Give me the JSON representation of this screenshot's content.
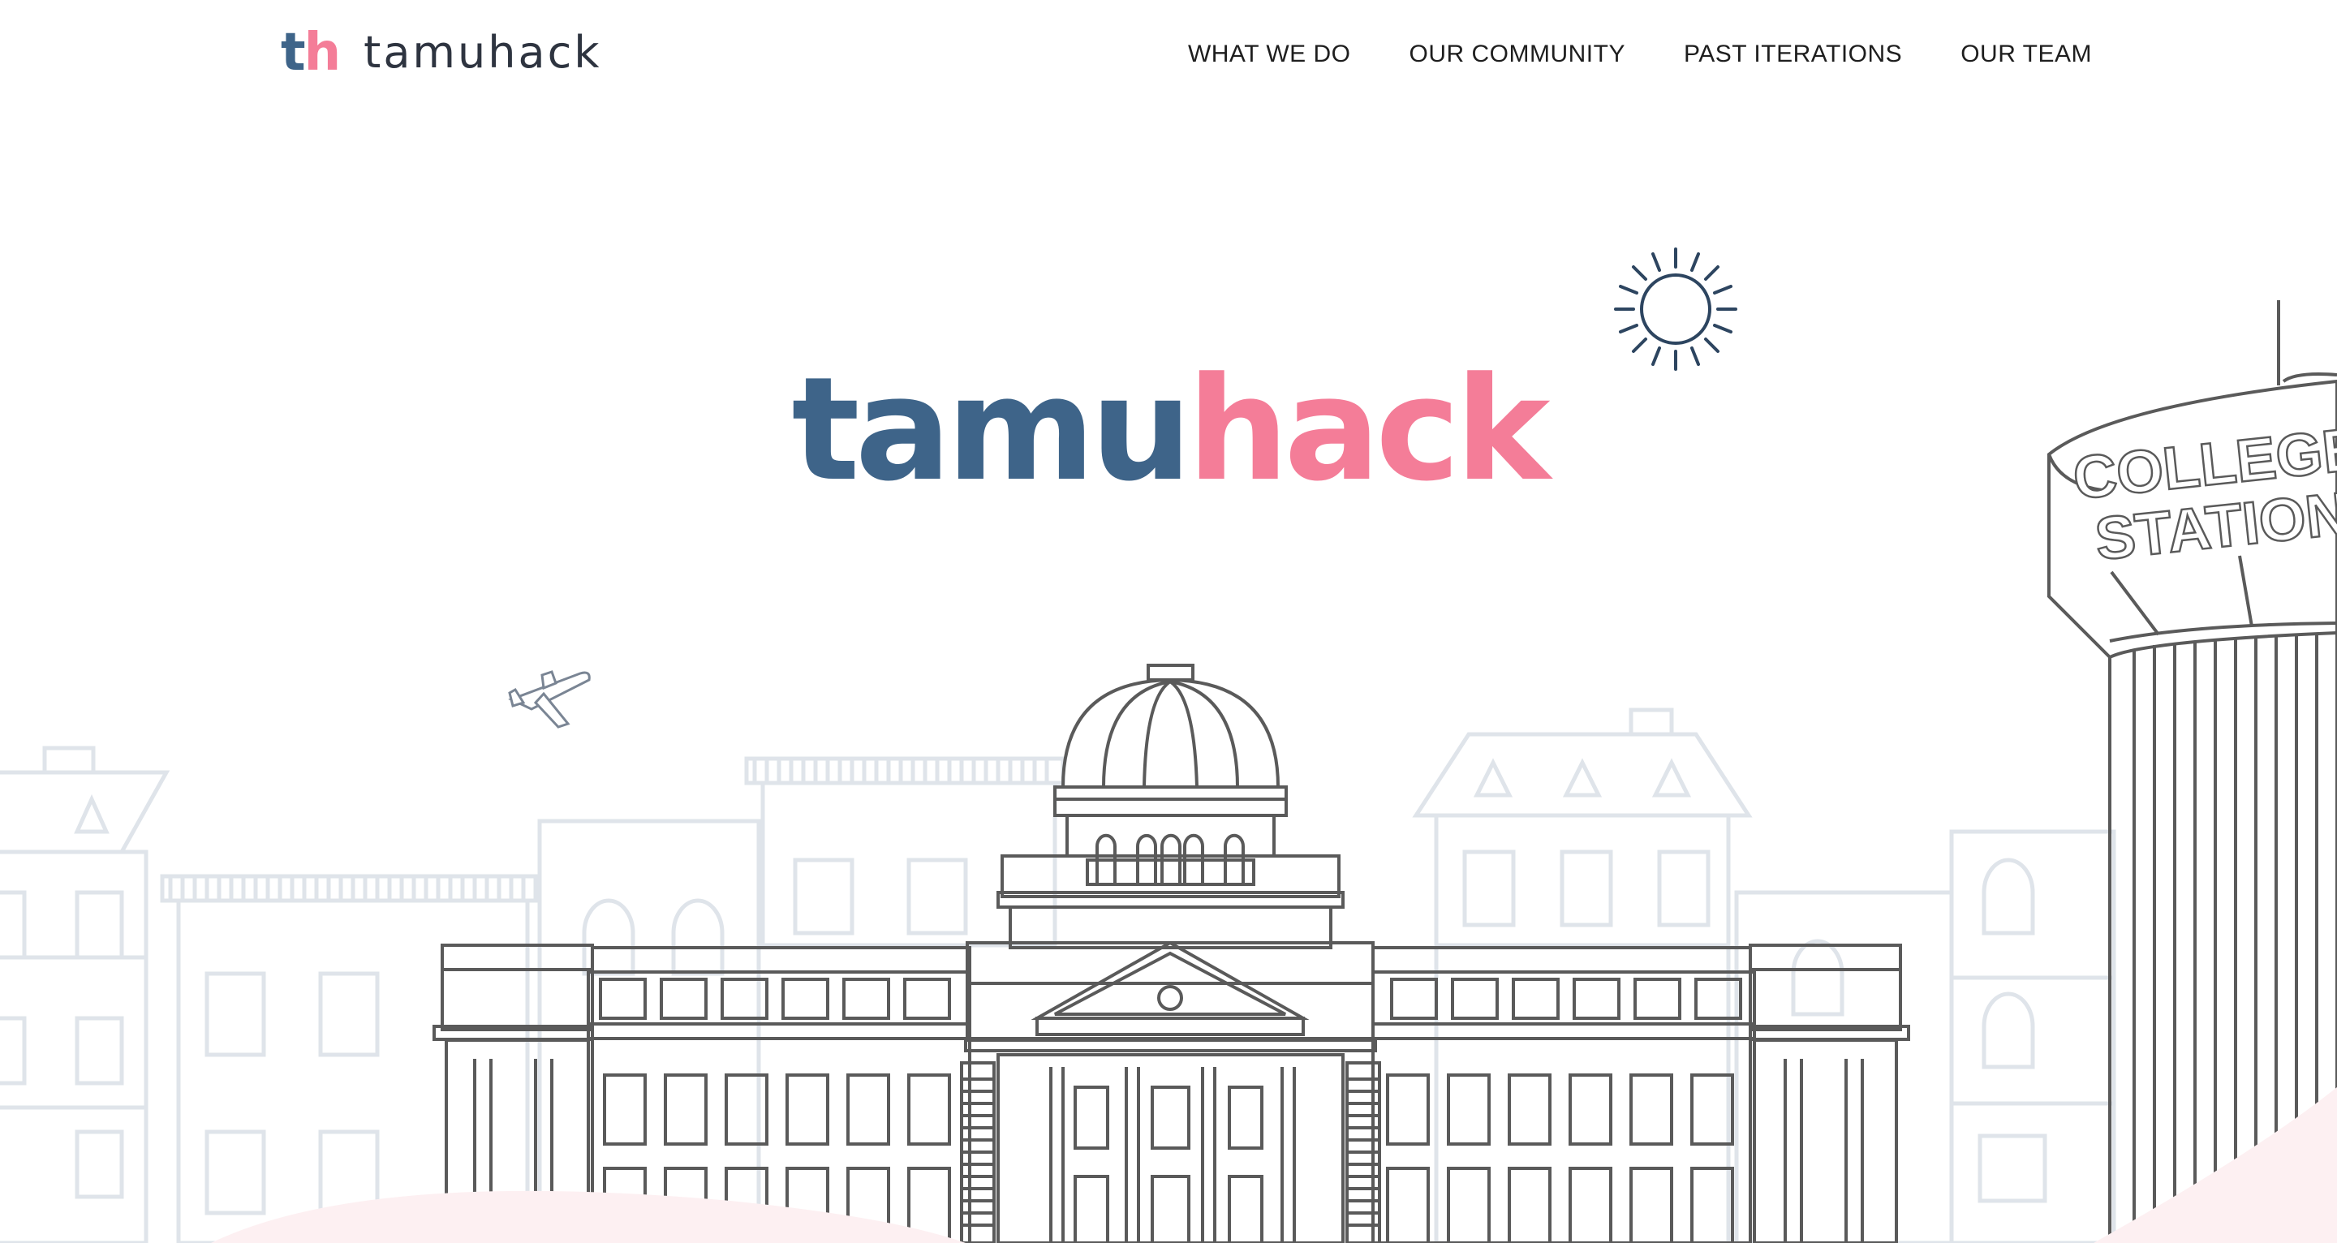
{
  "nav": {
    "logo_mark_t": "t",
    "logo_mark_h": "h",
    "logo_word": "tamuhack",
    "items": [
      {
        "label": "WHAT WE DO"
      },
      {
        "label": "OUR COMMUNITY"
      },
      {
        "label": "PAST ITERATIONS"
      },
      {
        "label": "OUR TEAM"
      }
    ]
  },
  "hero": {
    "title_part1": "tamu",
    "title_part2": "hack"
  },
  "tower": {
    "line1": "COLLEGE",
    "line2": "STATION"
  },
  "colors": {
    "blue": "#3e6489",
    "pink": "#f47d98",
    "line": "#5a5a5a",
    "faint": "#dfe4ea"
  },
  "icons": [
    "sun-icon",
    "airplane-icon"
  ]
}
